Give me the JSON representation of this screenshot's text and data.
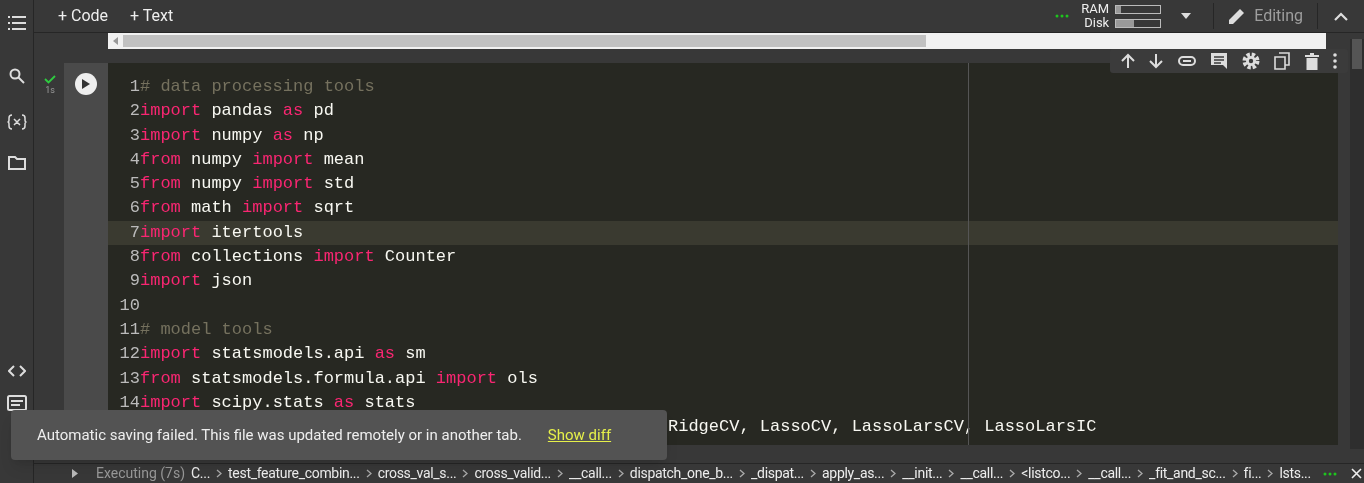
{
  "toolbar": {
    "add_buttons": [
      "+ Code",
      "+ Text"
    ],
    "resources": [
      {
        "label": "RAM",
        "level": 0.12
      },
      {
        "label": "Disk",
        "level": 0.4
      }
    ],
    "editing": "Editing"
  },
  "cell": {
    "executed": true,
    "duration": "1s",
    "lines": [
      {
        "number": "1",
        "tokens": [
          {
            "kind": "comment",
            "text": "# data processing tools"
          }
        ]
      },
      {
        "number": "2",
        "tokens": [
          {
            "kind": "keyword",
            "text": "import"
          },
          {
            "kind": "plain",
            "text": " pandas "
          },
          {
            "kind": "keyword",
            "text": "as"
          },
          {
            "kind": "plain",
            "text": " pd"
          }
        ]
      },
      {
        "number": "3",
        "tokens": [
          {
            "kind": "keyword",
            "text": "import"
          },
          {
            "kind": "plain",
            "text": " numpy "
          },
          {
            "kind": "keyword",
            "text": "as"
          },
          {
            "kind": "plain",
            "text": " np"
          }
        ]
      },
      {
        "number": "4",
        "tokens": [
          {
            "kind": "keyword",
            "text": "from"
          },
          {
            "kind": "plain",
            "text": " numpy "
          },
          {
            "kind": "keyword",
            "text": "import"
          },
          {
            "kind": "plain",
            "text": " mean"
          }
        ]
      },
      {
        "number": "5",
        "tokens": [
          {
            "kind": "keyword",
            "text": "from"
          },
          {
            "kind": "plain",
            "text": " numpy "
          },
          {
            "kind": "keyword",
            "text": "import"
          },
          {
            "kind": "plain",
            "text": " std"
          }
        ]
      },
      {
        "number": "6",
        "tokens": [
          {
            "kind": "keyword",
            "text": "from"
          },
          {
            "kind": "plain",
            "text": " math "
          },
          {
            "kind": "keyword",
            "text": "import"
          },
          {
            "kind": "plain",
            "text": " sqrt"
          }
        ]
      },
      {
        "number": "7",
        "active": true,
        "tokens": [
          {
            "kind": "keyword",
            "text": "import"
          },
          {
            "kind": "plain",
            "text": " itertools"
          }
        ]
      },
      {
        "number": "8",
        "tokens": [
          {
            "kind": "keyword",
            "text": "from"
          },
          {
            "kind": "plain",
            "text": " collections "
          },
          {
            "kind": "keyword",
            "text": "import"
          },
          {
            "kind": "plain",
            "text": " Counter"
          }
        ]
      },
      {
        "number": "9",
        "tokens": [
          {
            "kind": "keyword",
            "text": "import"
          },
          {
            "kind": "plain",
            "text": " json"
          }
        ]
      },
      {
        "number": "10"
      },
      {
        "number": "11",
        "tokens": [
          {
            "kind": "comment",
            "text": "# model tools"
          }
        ]
      },
      {
        "number": "12",
        "tokens": [
          {
            "kind": "keyword",
            "text": "import"
          },
          {
            "kind": "plain",
            "text": " statsmodels.api "
          },
          {
            "kind": "keyword",
            "text": "as"
          },
          {
            "kind": "plain",
            "text": " sm"
          }
        ]
      },
      {
        "number": "13",
        "tokens": [
          {
            "kind": "keyword",
            "text": "from"
          },
          {
            "kind": "plain",
            "text": " statsmodels.formula.api "
          },
          {
            "kind": "keyword",
            "text": "import"
          },
          {
            "kind": "plain",
            "text": " ols"
          }
        ]
      },
      {
        "number": "14",
        "tokens": [
          {
            "kind": "keyword",
            "text": "import"
          },
          {
            "kind": "plain",
            "text": " scipy.stats "
          },
          {
            "kind": "keyword",
            "text": "as"
          },
          {
            "kind": "plain",
            "text": " stats"
          }
        ]
      }
    ],
    "partial_line": "RidgeCV, LassoCV, LassoLarsCV, LassoLarsIC"
  },
  "snackbar": {
    "message": "Automatic saving failed. This file was updated remotely or in another tab.",
    "action": "Show diff"
  },
  "status_bar": {
    "executing": "Executing (7s)",
    "frames": [
      "C...",
      "test_feature_combin...",
      "cross_val_s...",
      "cross_valid...",
      "__call...",
      "dispatch_one_b...",
      "_dispat...",
      "apply_as...",
      "__init...",
      "__call...",
      "<listco...",
      "__call...",
      "_fit_and_sc...",
      "fi...",
      "lsts..."
    ]
  }
}
